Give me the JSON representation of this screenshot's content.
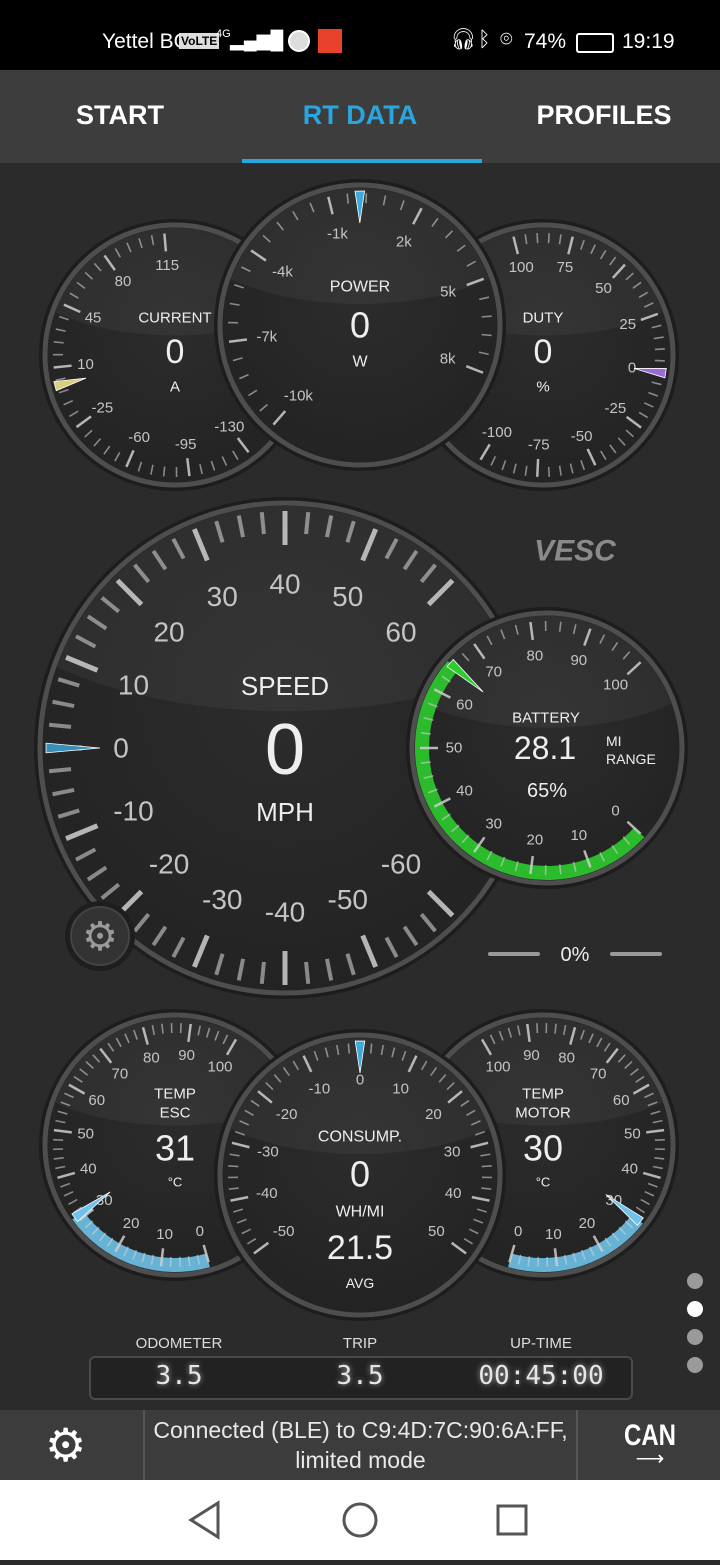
{
  "status_bar": {
    "carrier": "Yettel BG",
    "volte": "VoLTE",
    "network": "4G",
    "battery": "74%",
    "time": "19:19",
    "icons": [
      "signal-icon",
      "cloud-icon",
      "circle-icon",
      "app-icon",
      "headset-icon",
      "bluetooth-icon",
      "location-icon",
      "battery-icon"
    ]
  },
  "tabs": [
    {
      "label": "START"
    },
    {
      "label": "RT DATA",
      "active": true
    },
    {
      "label": "PROFILES"
    }
  ],
  "accent": "#2aa6de",
  "gauges": {
    "current": {
      "title": "CURRENT",
      "value": "0",
      "unit": "A",
      "labels": [
        "115",
        "80",
        "45",
        "10",
        "-25",
        "-60",
        "-95",
        "-130"
      ],
      "needle_value": 0,
      "needle_color": "#d8d07a"
    },
    "power": {
      "title": "POWER",
      "value": "0",
      "unit": "W",
      "labels": [
        "-10k",
        "-7k",
        "-4k",
        "-1k",
        "2k",
        "5k",
        "8k"
      ],
      "needle_value": 0,
      "needle_color": "#3fa9dc"
    },
    "duty": {
      "title": "DUTY",
      "value": "0",
      "unit": "%",
      "labels": [
        "100",
        "75",
        "50",
        "25",
        "0",
        "-25",
        "-50",
        "-75",
        "-100"
      ],
      "needle_value": 0,
      "needle_color": "#9a6ad8"
    },
    "speed": {
      "title": "SPEED",
      "value": "0",
      "unit": "MPH",
      "labels": [
        "-60",
        "-50",
        "-40",
        "-30",
        "-20",
        "-10",
        "0",
        "10",
        "20",
        "30",
        "40",
        "50",
        "60"
      ],
      "needle_value": 0,
      "needle_color": "#3a8fb8"
    },
    "battery": {
      "title": "BATTERY",
      "value": "28.1",
      "unit_line1": "MI",
      "unit_line2": "RANGE",
      "percent": "65%",
      "level": 65,
      "labels": [
        "0",
        "10",
        "20",
        "30",
        "40",
        "50",
        "60",
        "70",
        "80",
        "90",
        "100"
      ],
      "arc_color": "#2ecc2e"
    },
    "temp_esc": {
      "title_line1": "TEMP",
      "title_line2": "ESC",
      "value": "31",
      "unit": "°C",
      "level": 31,
      "labels": [
        "0",
        "10",
        "20",
        "30",
        "40",
        "50",
        "60",
        "70",
        "80",
        "90",
        "100"
      ],
      "arc_color": "#6ec3ea"
    },
    "consumption": {
      "title": "CONSUMP.",
      "value": "0",
      "unit": "WH/MI",
      "avg_value": "21.5",
      "avg_label": "AVG",
      "labels": [
        "-50",
        "-40",
        "-30",
        "-20",
        "-10",
        "0",
        "10",
        "20",
        "30",
        "40",
        "50"
      ],
      "needle_value": 0,
      "needle_color": "#3fa9dc"
    },
    "temp_motor": {
      "title_line1": "TEMP",
      "title_line2": "MOTOR",
      "value": "30",
      "unit": "°C",
      "level": 30,
      "labels": [
        "0",
        "10",
        "20",
        "30",
        "40",
        "50",
        "60",
        "70",
        "80",
        "90",
        "100"
      ],
      "arc_color": "#6ec3ea"
    }
  },
  "logo": "VESC",
  "throttle": {
    "value": "0%"
  },
  "odometer": {
    "label": "ODOMETER",
    "value": "3.5"
  },
  "trip": {
    "label": "TRIP",
    "value": "3.5"
  },
  "uptime": {
    "label": "UP-TIME",
    "value": "00:45:00"
  },
  "pages": {
    "count": 4,
    "active": 1
  },
  "bottom": {
    "connection": "Connected (BLE) to C9:4D:7C:90:6A:FF, limited mode",
    "can_label": "CAN"
  }
}
